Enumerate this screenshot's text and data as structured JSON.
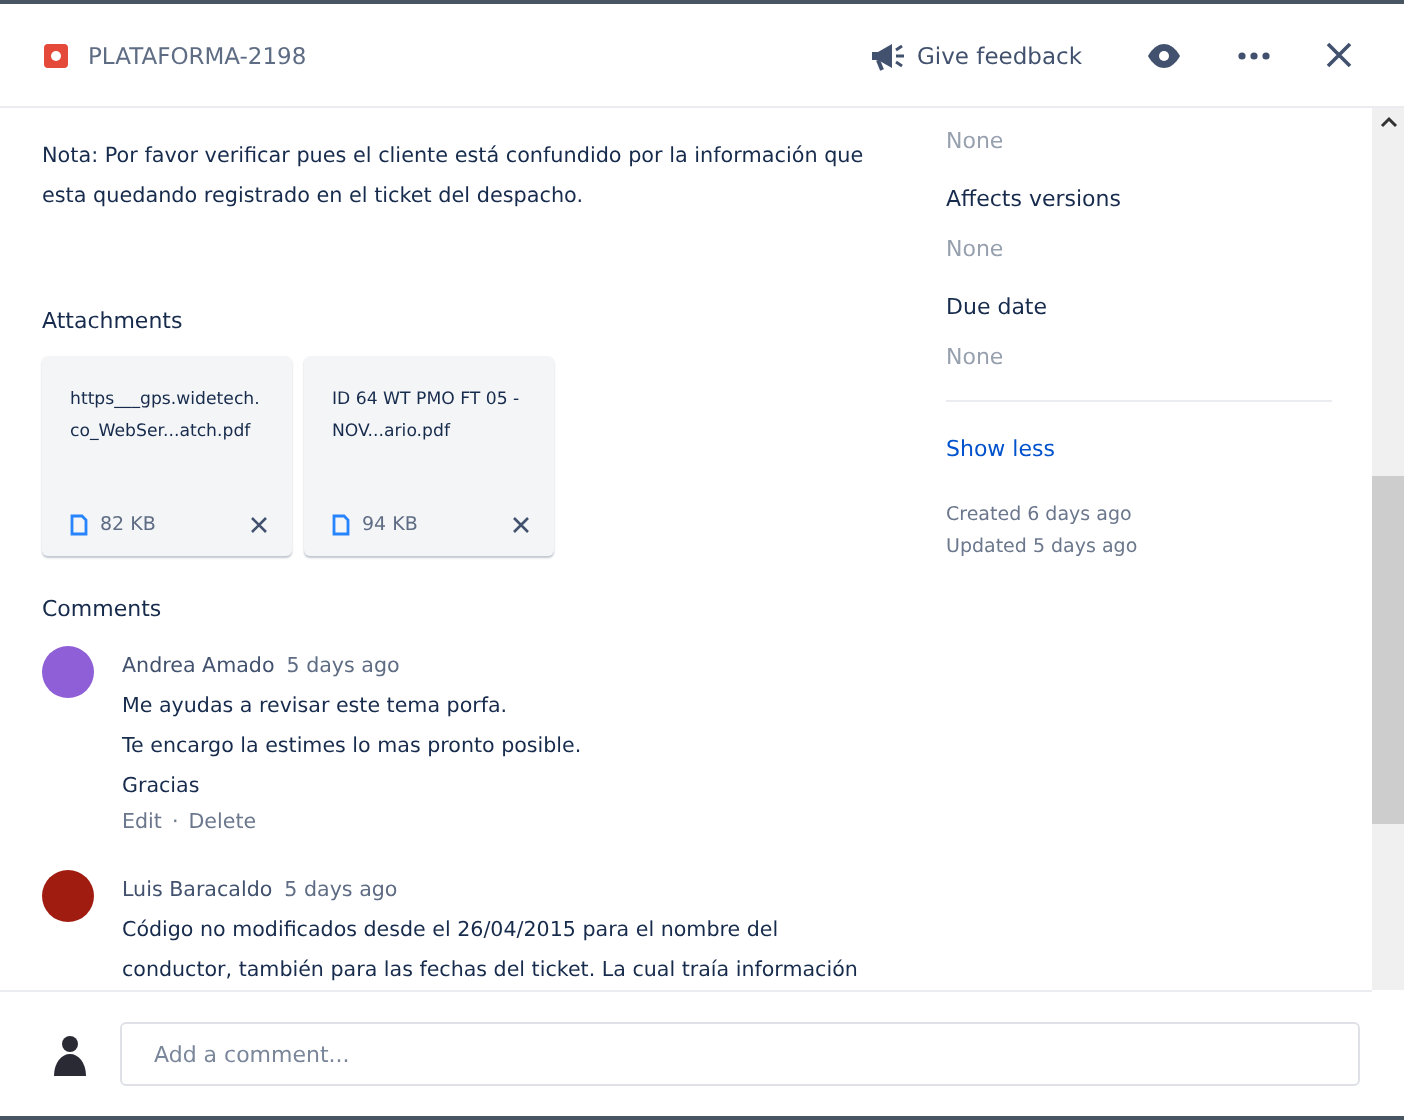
{
  "header": {
    "issue_key": "PLATAFORMA-2198",
    "feedback": "Give feedback"
  },
  "description": "Nota: Por favor verificar pues el cliente está confundido por la información que esta quedando registrado en el ticket del despacho.",
  "attachments": {
    "title": "Attachments",
    "files": [
      {
        "name": "https___gps.widetech.co_WebSer...atch.pdf",
        "size": "82 KB"
      },
      {
        "name": "ID 64 WT PMO FT 05 - NOV...ario.pdf",
        "size": "94 KB"
      }
    ]
  },
  "comments": {
    "title": "Comments",
    "items": [
      {
        "author": "Andrea Amado",
        "time": "5 days ago",
        "color": "#8e5fd6",
        "lines": [
          "Me ayudas a revisar este tema porfa.",
          "Te encargo la estimes lo mas pronto posible.",
          "Gracias"
        ],
        "actions": [
          "Edit",
          "Delete"
        ],
        "separator": "·"
      },
      {
        "author": "Luis Baracaldo",
        "time": "5 days ago",
        "color": "#a01c10",
        "lines": [
          "Código no modificados desde el 26/04/2015 para el nombre del",
          "conductor, también para las fechas del ticket. La cual traía información"
        ]
      }
    ]
  },
  "sidebar": {
    "fields": [
      {
        "value": "None"
      },
      {
        "label": "Affects versions",
        "value": "None"
      },
      {
        "label": "Due date",
        "value": "None"
      }
    ],
    "show_less": "Show less",
    "created": "Created 6 days ago",
    "updated": "Updated 5 days ago"
  },
  "composer": {
    "placeholder": "Add a comment..."
  }
}
